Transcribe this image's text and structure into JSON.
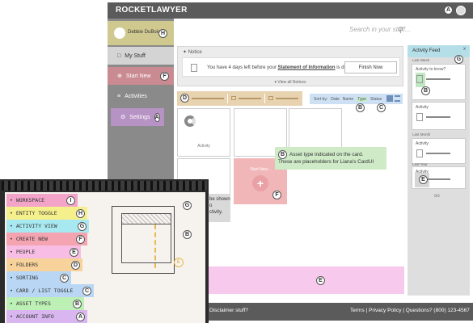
{
  "app": {
    "logo": "ROCKETLAWYER",
    "account_badge": "A"
  },
  "sidebar": {
    "user": {
      "name": "Debbie DuBois",
      "badge": "H"
    },
    "items": [
      {
        "label": "My Stuff"
      },
      {
        "label": "Start New",
        "badge": "F"
      },
      {
        "label": "Activities"
      },
      {
        "label": "Settings",
        "badge": "A"
      }
    ]
  },
  "search": {
    "placeholder": "Search in your stuff..."
  },
  "notice": {
    "title": "Notice",
    "text_before": "You have 4 days left before your ",
    "text_link": "Statement of Information",
    "text_after": " is due.",
    "button": "Finish Now",
    "view_all": "View all Notices"
  },
  "folders": {
    "badge": "D"
  },
  "sort": {
    "label": "Sort by:",
    "options": [
      "Date",
      "Name",
      "Type",
      "Status"
    ],
    "badge_b": "B",
    "badge_c": "C"
  },
  "cards": {
    "activity_label": "Activity",
    "start_new_label": "Start New...",
    "start_new_badge": "F"
  },
  "callout": {
    "badge": "B",
    "line1": "Asset type indicated on the card.",
    "line2": "These are placeholders for Liana's CardUI"
  },
  "gray_note": {
    "lines": [
      "be shown",
      "o",
      "ctivity."
    ]
  },
  "pink_bar": {
    "badge": "E"
  },
  "footer": {
    "left": "Disclaimer stuff?",
    "right": "Terms  |  Privacy Policy  |  Questions? (800) 123-4567"
  },
  "feed": {
    "title": "Activity Feed",
    "close": "x",
    "badge": "G",
    "sections": [
      "Last Week",
      "Last Month",
      "Last Year"
    ],
    "card1_title": "Activity to know?",
    "card1_badge": "B",
    "card2_title": "Activity",
    "card3_title": "Activity",
    "card4_title": "Activity",
    "card4_badge": "E",
    "more": "oo"
  },
  "notebook": {
    "stickies": [
      {
        "label": "WORKSPACE",
        "badge": "I",
        "color": "#f4a4c8"
      },
      {
        "label": "ENTITY TOGGLE",
        "badge": "H",
        "color": "#f6f08c"
      },
      {
        "label": "ACTIVITY VIEW",
        "badge": "G",
        "color": "#a8e8f0"
      },
      {
        "label": "CREATE NEW",
        "badge": "F",
        "color": "#f4a4b0"
      },
      {
        "label": "PEOPLE",
        "badge": "E",
        "color": "#f8bde4"
      },
      {
        "label": "FOLDERS",
        "badge": "D",
        "color": "#f7d29a"
      },
      {
        "label": "SORTING",
        "badge": "C",
        "color": "#b9d7f4"
      },
      {
        "label": "CARD / LIST TOGGLE",
        "badge": "C",
        "color": "#b9d7f4"
      },
      {
        "label": "ASSET TYPES",
        "badge": "B",
        "color": "#bdf0b5"
      },
      {
        "label": "ACCOUNT INFO",
        "badge": "A",
        "color": "#d9b6f0"
      }
    ],
    "sketch_badges": [
      "G",
      "B",
      "E"
    ]
  }
}
